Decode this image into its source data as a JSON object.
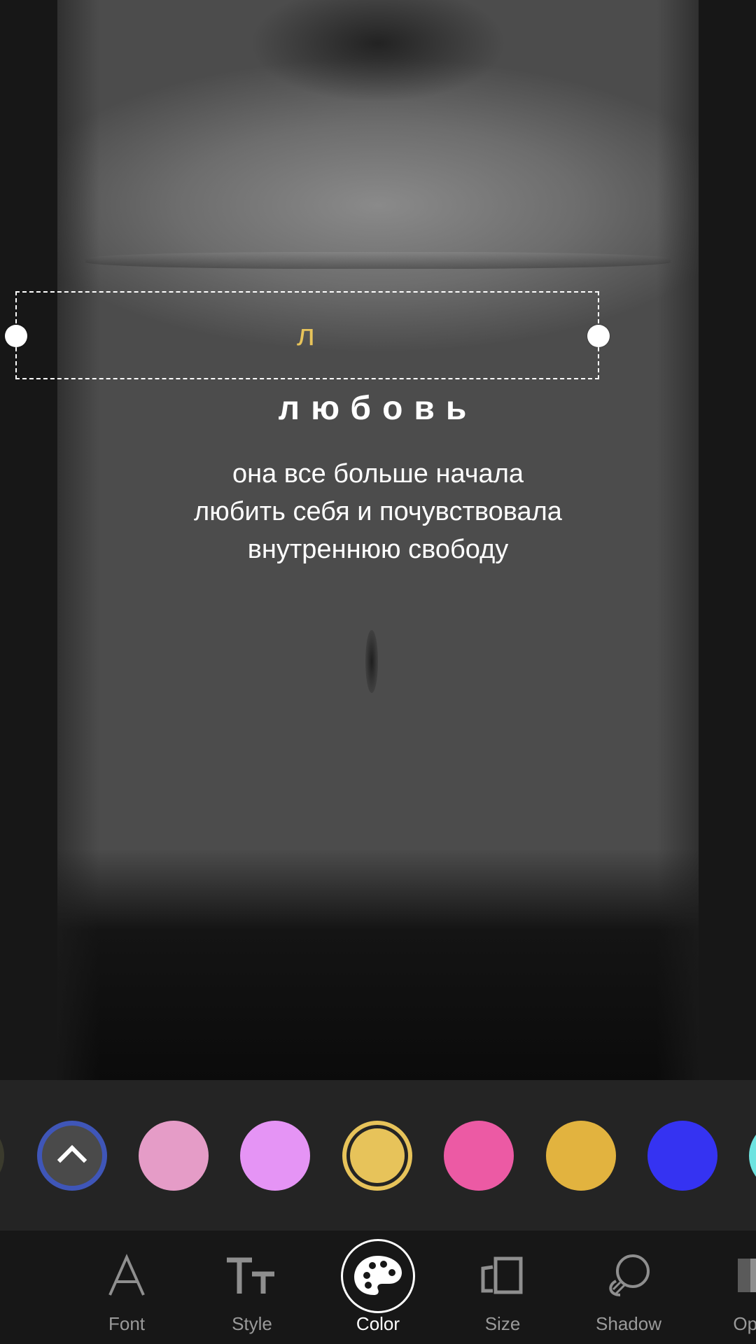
{
  "canvas": {
    "text_box": {
      "edit_letter": "л"
    },
    "headline": "любовь",
    "caption": "она все больше начала\nлюбить себя и почувствовала\nвнутреннюю свободу"
  },
  "palette": {
    "expand_icon": "chevron-up-icon",
    "selected_color": "#e7c35a",
    "swatches": [
      {
        "color": "#e59cc7"
      },
      {
        "color": "#e594f5"
      },
      {
        "color": "#e7c35a"
      },
      {
        "color": "#ec5aa4"
      },
      {
        "color": "#e2b33f"
      },
      {
        "color": "#3533f2"
      },
      {
        "color": "#6ee3e0"
      }
    ]
  },
  "toolbar": {
    "tools": [
      {
        "label": "Font",
        "icon": "font-a-icon"
      },
      {
        "label": "Style",
        "icon": "text-style-icon"
      },
      {
        "label": "Color",
        "icon": "palette-icon"
      },
      {
        "label": "Size",
        "icon": "size-icon"
      },
      {
        "label": "Shadow",
        "icon": "shadow-icon"
      },
      {
        "label": "Opa",
        "icon": "opacity-icon"
      }
    ],
    "active": "Color"
  }
}
